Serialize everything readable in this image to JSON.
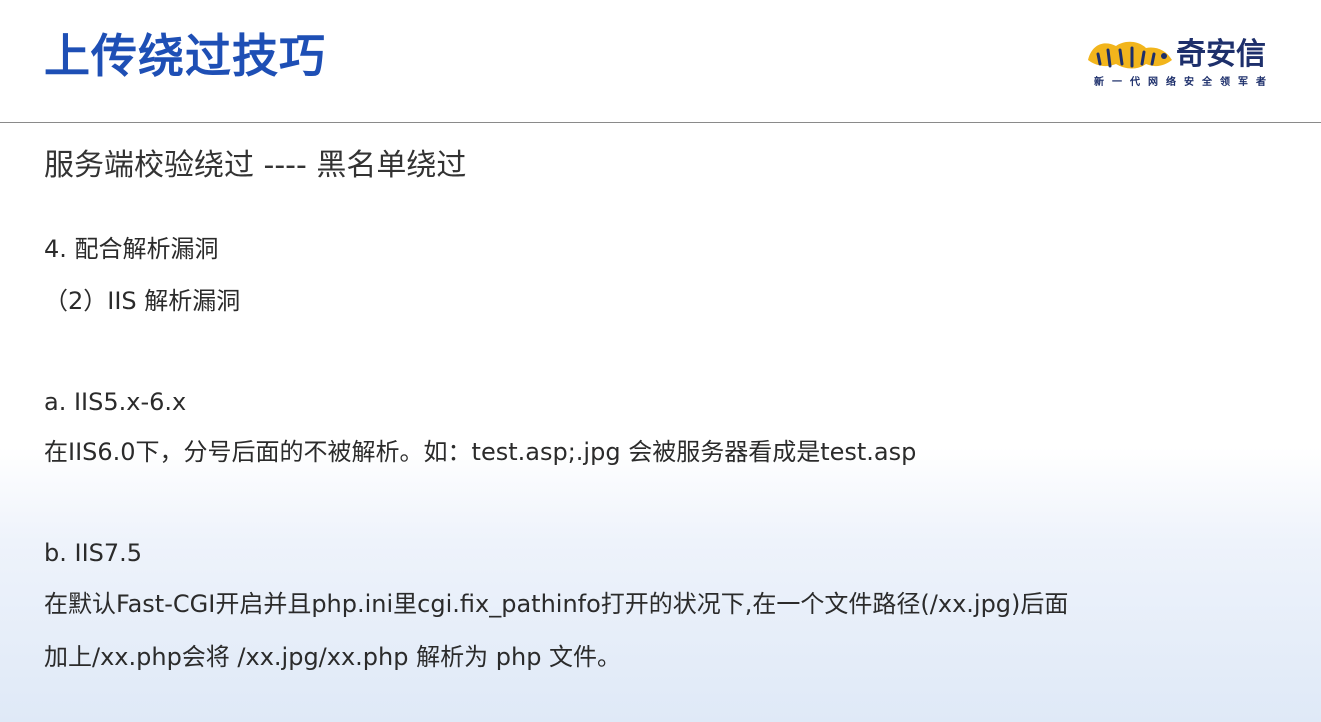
{
  "header": {
    "title": "上传绕过技巧"
  },
  "logo": {
    "name": "奇安信",
    "slogan": "新一代网络安全领军者"
  },
  "content": {
    "subtitle": "服务端校验绕过 ---- 黑名单绕过",
    "lines": [
      "4. 配合解析漏洞",
      "（2）IIS 解析漏洞",
      "a. IIS5.x-6.x",
      "在IIS6.0下，分号后面的不被解析。如：test.asp;.jpg 会被服务器看成是test.asp",
      "b. IIS7.5",
      "在默认Fast-CGI开启并且php.ini里cgi.fix_pathinfo打开的状况下,在一个文件路径(/xx.jpg)后面",
      "加上/xx.php会将 /xx.jpg/xx.php 解析为 php 文件。"
    ]
  },
  "colors": {
    "title": "#1e4fb5",
    "logo_text": "#1d2f6b",
    "logo_accent": "#f2b51c",
    "body_text": "#2b2b2b",
    "rule": "#8a8a8a",
    "background_bottom": "#dfe9f7"
  }
}
